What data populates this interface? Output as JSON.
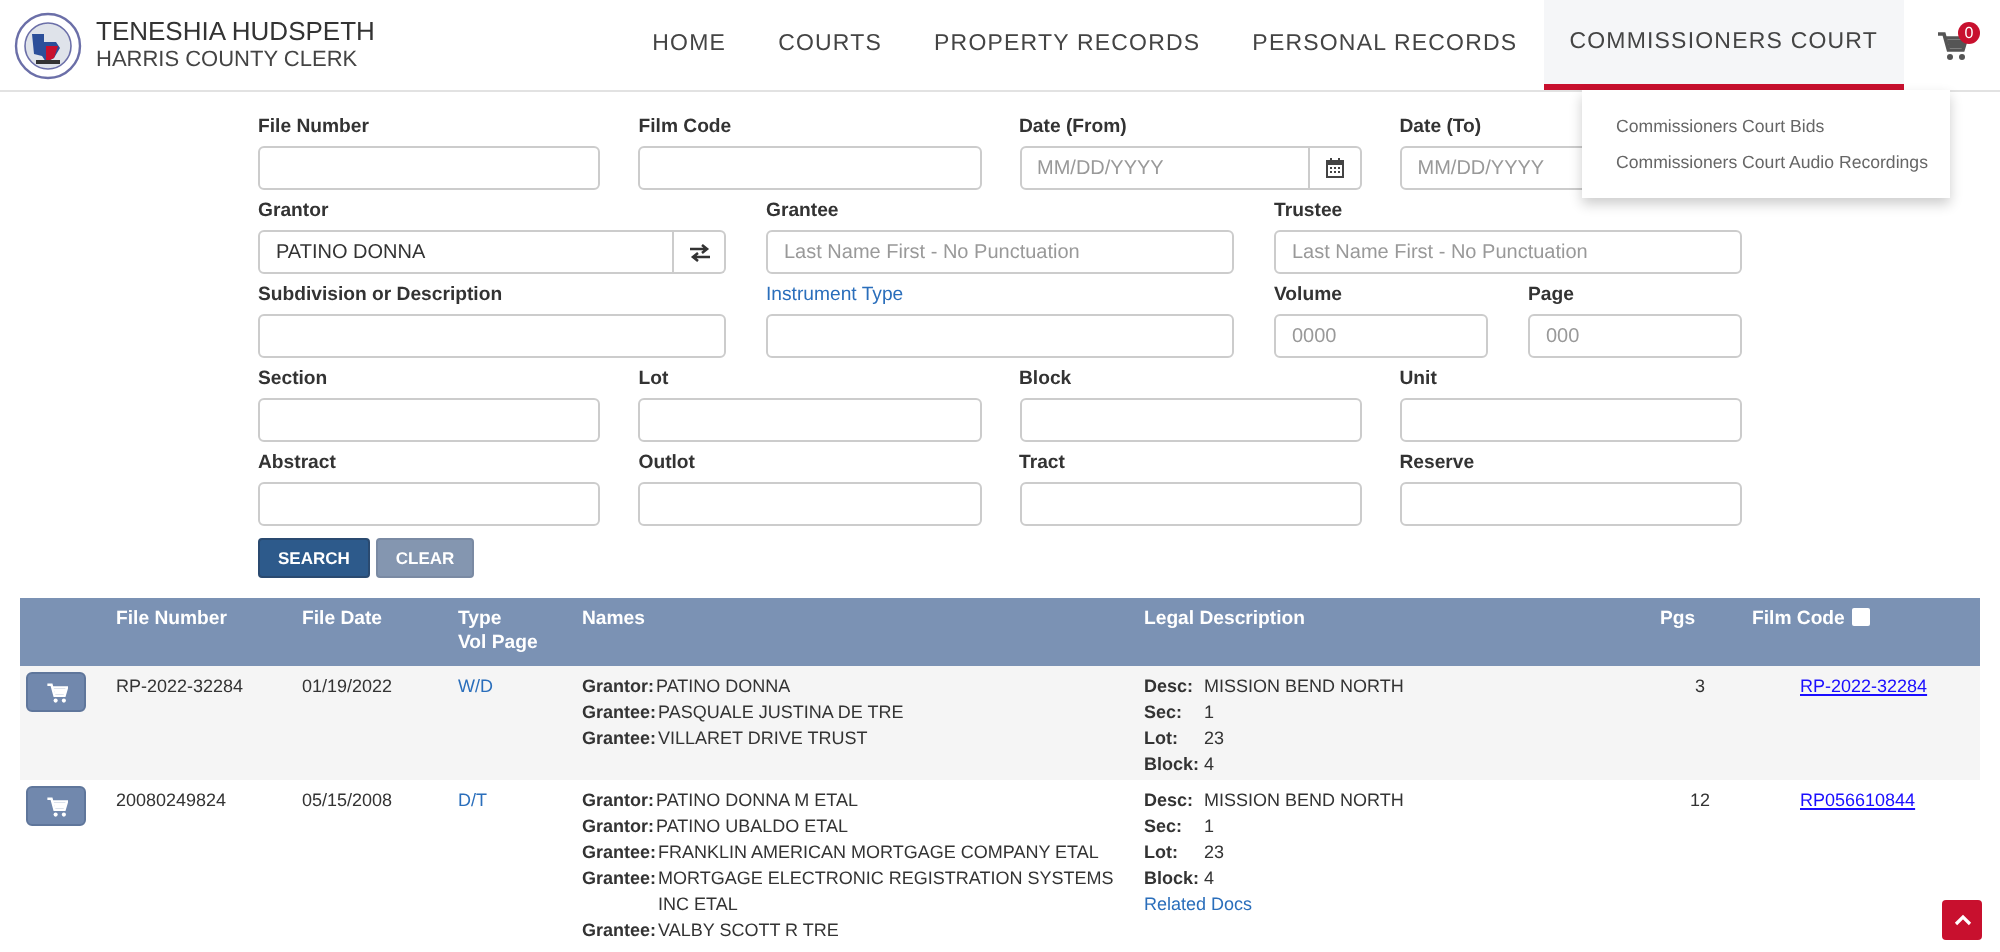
{
  "header": {
    "title": "TENESHIA HUDSPETH",
    "subtitle": "HARRIS COUNTY CLERK",
    "nav": [
      {
        "label": "HOME",
        "selected": false
      },
      {
        "label": "COURTS",
        "selected": false
      },
      {
        "label": "PROPERTY RECORDS",
        "selected": false
      },
      {
        "label": "PERSONAL RECORDS",
        "selected": false
      },
      {
        "label": "COMMISSIONERS COURT",
        "selected": true
      }
    ],
    "cart_count": "0",
    "dropdown": [
      "Commissioners Court Bids",
      "Commissioners Court Audio Recordings"
    ]
  },
  "form": {
    "rows": [
      [
        {
          "label": "File Number",
          "kind": "text"
        },
        {
          "label": "Film Code",
          "kind": "text"
        },
        {
          "label": "Date (From)",
          "kind": "date",
          "placeholder": "MM/DD/YYYY"
        },
        {
          "label": "Date (To)",
          "kind": "text",
          "placeholder": "MM/DD/YYYY"
        }
      ],
      [
        {
          "label": "Grantor",
          "kind": "swap",
          "value": "PATINO DONNA"
        },
        {
          "label": "Grantee",
          "kind": "text",
          "placeholder": "Last Name First - No Punctuation"
        },
        {
          "label": "Trustee",
          "kind": "text",
          "placeholder": "Last Name First - No Punctuation"
        }
      ],
      [
        {
          "label": "Subdivision or Description",
          "kind": "text"
        },
        {
          "label": "Instrument Type",
          "kind": "lookup"
        },
        {
          "label": "Volume",
          "kind": "text",
          "placeholder": "0000"
        },
        {
          "label": "Page",
          "kind": "text",
          "placeholder": "000"
        }
      ],
      [
        {
          "label": "Section",
          "kind": "text"
        },
        {
          "label": "Lot",
          "kind": "text"
        },
        {
          "label": "Block",
          "kind": "text"
        },
        {
          "label": "Unit",
          "kind": "text"
        }
      ],
      [
        {
          "label": "Abstract",
          "kind": "text"
        },
        {
          "label": "Outlot",
          "kind": "text"
        },
        {
          "label": "Tract",
          "kind": "text"
        },
        {
          "label": "Reserve",
          "kind": "text"
        }
      ]
    ],
    "buttons": [
      {
        "label": "SEARCH",
        "kind": "primary"
      },
      {
        "label": "CLEAR",
        "kind": "secondary"
      }
    ]
  },
  "table": {
    "columns": [
      {
        "label": "File Number"
      },
      {
        "label": "File Date"
      },
      {
        "label": "Type",
        "sublabel": "Vol Page"
      },
      {
        "label": "Names"
      },
      {
        "label": "Legal Description"
      },
      {
        "label": "Pgs"
      },
      {
        "label": "Film Code",
        "checked": false
      }
    ],
    "rows": [
      {
        "file_number": "RP-2022-32284",
        "file_date": "01/19/2022",
        "type": "W/D",
        "names": [
          {
            "role": "Grantor:",
            "name": "PATINO DONNA"
          },
          {
            "role": "Grantee:",
            "name": "PASQUALE JUSTINA DE TRE"
          },
          {
            "role": "Grantee:",
            "name": "VILLARET DRIVE TRUST"
          }
        ],
        "legal": [
          {
            "label": "Desc:",
            "value": "MISSION BEND NORTH"
          },
          {
            "label": "Sec:",
            "value": "1"
          },
          {
            "label": "Lot:",
            "value": "23"
          },
          {
            "label": "Block:",
            "value": "4"
          }
        ],
        "pgs": "3",
        "film_code": "RP-2022-32284"
      },
      {
        "file_number": "20080249824",
        "file_date": "05/15/2008",
        "type": "D/T",
        "names": [
          {
            "role": "Grantor:",
            "name": "PATINO DONNA M ETAL"
          },
          {
            "role": "Grantor:",
            "name": "PATINO UBALDO ETAL"
          },
          {
            "role": "Grantee:",
            "name": "FRANKLIN AMERICAN MORTGAGE COMPANY ETAL"
          },
          {
            "role": "Grantee:",
            "name": "MORTGAGE ELECTRONIC REGISTRATION SYSTEMS INC ETAL"
          },
          {
            "role": "Grantee:",
            "name": "VALBY SCOTT R TRE"
          }
        ],
        "legal": [
          {
            "label": "Desc:",
            "value": "MISSION BEND NORTH"
          },
          {
            "label": "Sec:",
            "value": "1"
          },
          {
            "label": "Lot:",
            "value": "23"
          },
          {
            "label": "Block:",
            "value": "4"
          }
        ],
        "related_docs": "Related Docs",
        "pgs": "12",
        "film_code": "RP056610844"
      }
    ]
  }
}
